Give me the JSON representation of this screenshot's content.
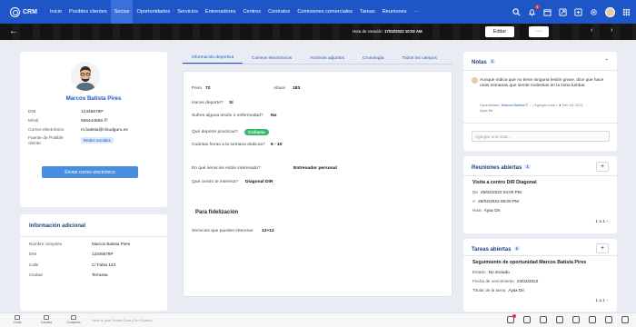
{
  "app": {
    "logo_text": "CRM"
  },
  "nav": {
    "items": [
      "Inicio",
      "Posibles clientes",
      "Socios",
      "Oportunidades",
      "Servicios",
      "Entrenadores",
      "Centros",
      "Contratos",
      "Comisiones comerciales",
      "Tareas",
      "Reuniones",
      "···"
    ],
    "active_index": 2,
    "notification_count": "4"
  },
  "banner": {
    "creation_label": "Hora de creación",
    "creation_value": "17/02/2022 10:02 AM",
    "edit_label": "Editar",
    "more_label": "···",
    "prev_label": "‹",
    "next_label": "›"
  },
  "profile": {
    "name": "Marcos Batista Pires",
    "fields": [
      {
        "label": "DNI",
        "value": "12345678P"
      },
      {
        "label": "Móvil",
        "value": "666444555"
      },
      {
        "label": "Correo electrónico",
        "value": "m.batista@cloudguru.es"
      },
      {
        "label": "Fuente de Posible cliente",
        "value": "Redes sociales"
      }
    ],
    "email_button": "Enviar correo electrónico"
  },
  "additional": {
    "title": "Información adicional",
    "rows": [
      {
        "label": "Nombre completo",
        "value": "Marcos Batista Pires"
      },
      {
        "label": "DNI",
        "value": "12345678P"
      },
      {
        "label": "Calle",
        "value": "C/ Falsa 123"
      },
      {
        "label": "Ciudad",
        "value": "Terrassa"
      }
    ]
  },
  "tabs": [
    "Información deportiva",
    "Correos electrónicos",
    "Archivos adjuntos",
    "Cronología",
    "Todos los campos"
  ],
  "sport": {
    "peso_label": "Peso",
    "peso_value": "72",
    "altura_label": "Altura",
    "altura_value": "183",
    "deporte_label": "Haces deporte?",
    "deporte_value": "Sí",
    "lesion_label": "Sufres alguna lesión o enfermedad?",
    "lesion_value": "No",
    "practicas_label": "Qué deporte practicas?",
    "practicas_value": "Ciclismo",
    "horas_label": "Cuántas horas a la semana dedicas?",
    "horas_value": "6 - 10",
    "servicios_label": "En qué servicios estás interesado?",
    "servicios_value": "Entrenador personal",
    "centro_label": "Qué centro te interesa?",
    "centro_value": "Diagonal DiR",
    "fidelizacion_title": "Para fidelización",
    "fid_label": "Servicios que pueden interesar",
    "fid_value": "12+12"
  },
  "notes": {
    "title": "Notas",
    "count": "1",
    "text": "Aunque indica que no tiene ninguna lesión grave, dice que hace unas semanas que siente molestias en la zona lumbar.",
    "meta_prefix": "Oportunidad",
    "meta_link": "Marcos Batista P...",
    "meta_add": "• Agregar nota •",
    "meta_date": "Feb 16, 2022",
    "meta_author": "Áyax Dir",
    "input_placeholder": "Agregar una nota..."
  },
  "meetings": {
    "title": "Reuniones abiertas",
    "count": "1",
    "add_label": "+",
    "item_title": "Visita a centro DiR Diagonal",
    "de_label": "De",
    "de_value": "25/02/2022 04:00 PM",
    "a_label": "A",
    "a_value": "25/02/2022 05:00 PM",
    "host_label": "Host",
    "host_value": "Áyax Dir",
    "pagination": "1 a 1 ›"
  },
  "tasks": {
    "title": "Tareas abiertas",
    "count": "1",
    "add_label": "+",
    "item_title": "Seguimiento de oportunidad Marcos Batista Pires",
    "estado_label": "Estado",
    "estado_value": "No iniciado",
    "fecha_label": "Fecha de vencimiento",
    "fecha_value": "23/02/2022",
    "titular_label": "Titular de la tarea",
    "titular_value": "Áyax Dir",
    "pagination": "1 a 1 ›"
  },
  "bottombar": {
    "items": [
      "Chats",
      "Canales",
      "Contactos"
    ],
    "chat_hint": "Here is your Smart Chat (Ctrl+Space)"
  }
}
